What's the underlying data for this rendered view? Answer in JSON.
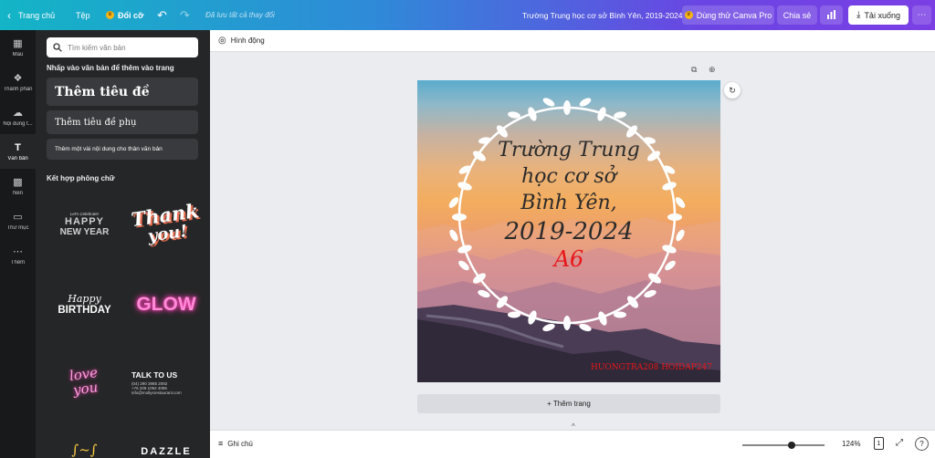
{
  "topbar": {
    "home": "Trang chủ",
    "file": "Tệp",
    "resize": "Đổi cỡ",
    "saved": "Đã lưu tất cả thay đổi",
    "title": "Trường Trung học cơ sở Bình Yên, 2019-2024",
    "try_pro": "Dùng thử Canva Pro",
    "share": "Chia sẻ",
    "download": "Tải xuống"
  },
  "rail": [
    {
      "label": "Mẫu",
      "icon": "template-icon"
    },
    {
      "label": "Thành phần",
      "icon": "elements-icon"
    },
    {
      "label": "Nội dung t...",
      "icon": "upload-icon"
    },
    {
      "label": "Văn bản",
      "icon": "text-icon"
    },
    {
      "label": "Nền",
      "icon": "background-icon"
    },
    {
      "label": "Thư mục",
      "icon": "folder-icon"
    },
    {
      "label": "Thêm",
      "icon": "more-icon"
    }
  ],
  "panel": {
    "search_placeholder": "Tìm kiếm văn bản",
    "add_hint": "Nhấp vào văn bản để thêm vào trang",
    "heading": "Thêm tiêu đề",
    "subheading": "Thêm tiêu đề phụ",
    "body": "Thêm một vài nội dung cho thân văn bản",
    "font_combos": "Kết hợp phông chữ",
    "cards": {
      "hny_small": "Let's Celebrate!",
      "hny_1": "HAPPY",
      "hny_2": "NEW YEAR",
      "thank_1": "Thank",
      "thank_2": "you!",
      "hb_1": "Happy",
      "hb_2": "BIRTHDAY",
      "glow": "GLOW",
      "love_1": "love",
      "love_2": "you",
      "talk_title": "TALK TO US",
      "talk_1": "(04) 290 3985 2092",
      "talk_2": "+76 209 1092 4095",
      "talk_3": "info@mollysrestaurant.com",
      "dazzle": "DAZZLE"
    }
  },
  "subtoolbar": {
    "animate": "Hình động"
  },
  "page": {
    "line1": "Trường Trung",
    "line2": "học cơ sở",
    "line3": "Bình Yên,",
    "line4": "2019-2024",
    "line5": "A6",
    "credit": "HUONGTRA208 HOIDAP247"
  },
  "add_page": "+ Thêm trang",
  "bottombar": {
    "notes": "Ghi chú",
    "zoom": "124%",
    "page_count": "1",
    "zoom_level": 0.6
  },
  "colors": {
    "accent": "#8b3dff",
    "canvas_bg": "#ebecf0",
    "panel_bg": "#252627",
    "rail_bg": "#18191b",
    "red_text": "#e8171a"
  }
}
